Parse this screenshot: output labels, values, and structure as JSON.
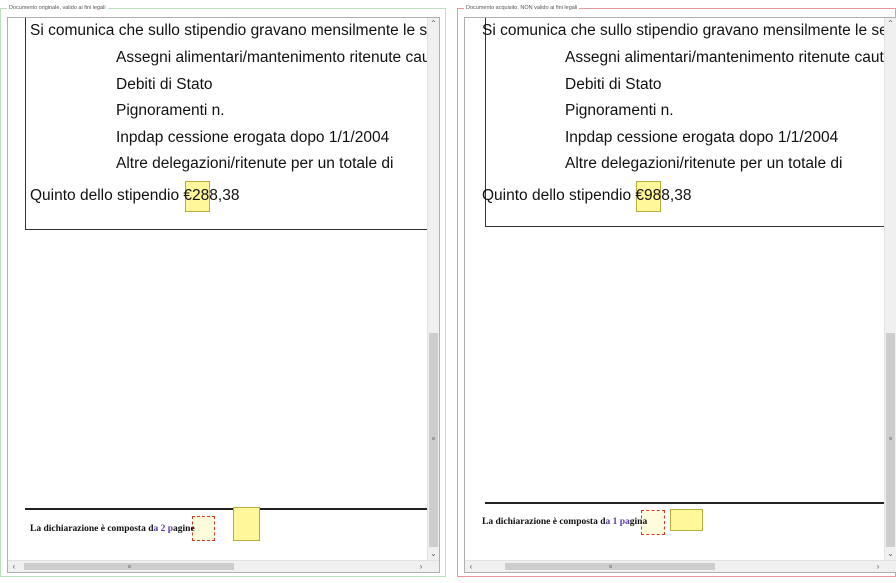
{
  "left_panel": {
    "legend": "Documento originale, valido ai fini legali",
    "intro": "Si comunica che sullo stipendio gravano mensilmente le se",
    "items": [
      "Assegni alimentari/mantenimento ritenute caute",
      "Debiti di Stato",
      "Pignoramenti n.",
      "Inpdap cessione erogata dopo 1/1/2004",
      "Altre delegazioni/ritenute per un totale di"
    ],
    "quinto_label": "Quinto dello stipendio ",
    "quinto_currency": "€",
    "quinto_highlight": "28",
    "quinto_rest": "8,38",
    "footer_prefix": "La dichiarazione è composta d",
    "footer_highlight": "a 2 p",
    "footer_rest": "agine"
  },
  "right_panel": {
    "legend": "Documento acquisito, NON valido ai fini legali",
    "intro": "Si comunica che sullo stipendio gravano mensilmente le se",
    "items": [
      "Assegni alimentari/mantenimento ritenute caute",
      "Debiti di Stato",
      "Pignoramenti n.",
      "Inpdap cessione erogata dopo 1/1/2004",
      "Altre delegazioni/ritenute per un totale di"
    ],
    "quinto_label": "Quinto dello stipendio ",
    "quinto_currency": "€",
    "quinto_highlight": "98",
    "quinto_rest": "8,38",
    "footer_prefix": "La dichiarazione è composta d",
    "footer_highlight": "a 1 pa",
    "footer_rest": "gina"
  },
  "scrollbar": {
    "up_icon": "chevron-up-icon",
    "down_icon": "chevron-down-icon",
    "left_icon": "chevron-left-icon",
    "right_icon": "chevron-right-icon"
  },
  "colors": {
    "highlight": "#fff79a",
    "diff_border": "#d23a2a",
    "original_frame": "#bfe0bf",
    "acquired_frame": "#e49a9a"
  }
}
